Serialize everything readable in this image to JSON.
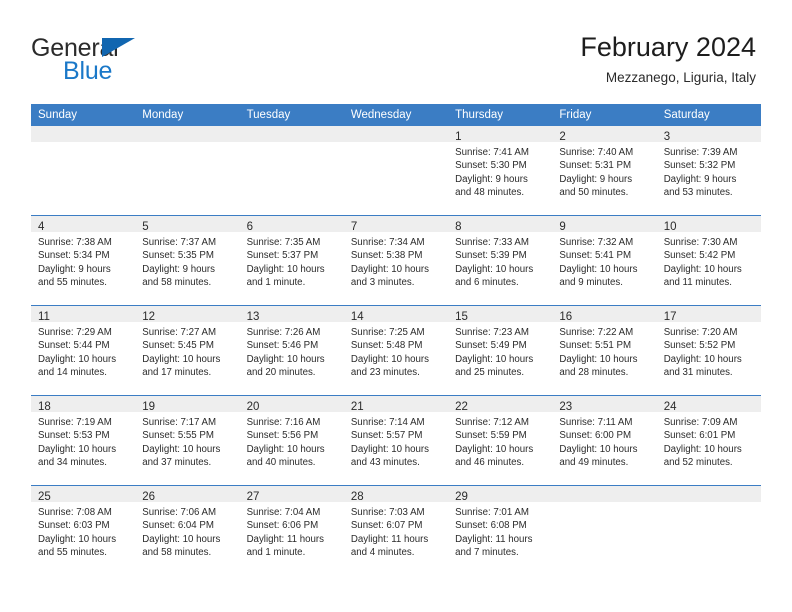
{
  "brand": {
    "name_part1": "General",
    "name_part2": "Blue",
    "flag_icon": "blue-triangle-flag",
    "accent_color": "#1a78c8"
  },
  "header": {
    "title": "February 2024",
    "subtitle": "Mezzanego, Liguria, Italy"
  },
  "theme": {
    "header_row_color": "#3b7dc4",
    "daynum_band_color": "#eeeeee",
    "text_color": "#2b2b2b"
  },
  "weekdays": [
    "Sunday",
    "Monday",
    "Tuesday",
    "Wednesday",
    "Thursday",
    "Friday",
    "Saturday"
  ],
  "weeks": [
    [
      {
        "day": "",
        "sunrise": "",
        "sunset": "",
        "daylight1": "",
        "daylight2": ""
      },
      {
        "day": "",
        "sunrise": "",
        "sunset": "",
        "daylight1": "",
        "daylight2": ""
      },
      {
        "day": "",
        "sunrise": "",
        "sunset": "",
        "daylight1": "",
        "daylight2": ""
      },
      {
        "day": "",
        "sunrise": "",
        "sunset": "",
        "daylight1": "",
        "daylight2": ""
      },
      {
        "day": "1",
        "sunrise": "Sunrise: 7:41 AM",
        "sunset": "Sunset: 5:30 PM",
        "daylight1": "Daylight: 9 hours",
        "daylight2": "and 48 minutes."
      },
      {
        "day": "2",
        "sunrise": "Sunrise: 7:40 AM",
        "sunset": "Sunset: 5:31 PM",
        "daylight1": "Daylight: 9 hours",
        "daylight2": "and 50 minutes."
      },
      {
        "day": "3",
        "sunrise": "Sunrise: 7:39 AM",
        "sunset": "Sunset: 5:32 PM",
        "daylight1": "Daylight: 9 hours",
        "daylight2": "and 53 minutes."
      }
    ],
    [
      {
        "day": "4",
        "sunrise": "Sunrise: 7:38 AM",
        "sunset": "Sunset: 5:34 PM",
        "daylight1": "Daylight: 9 hours",
        "daylight2": "and 55 minutes."
      },
      {
        "day": "5",
        "sunrise": "Sunrise: 7:37 AM",
        "sunset": "Sunset: 5:35 PM",
        "daylight1": "Daylight: 9 hours",
        "daylight2": "and 58 minutes."
      },
      {
        "day": "6",
        "sunrise": "Sunrise: 7:35 AM",
        "sunset": "Sunset: 5:37 PM",
        "daylight1": "Daylight: 10 hours",
        "daylight2": "and 1 minute."
      },
      {
        "day": "7",
        "sunrise": "Sunrise: 7:34 AM",
        "sunset": "Sunset: 5:38 PM",
        "daylight1": "Daylight: 10 hours",
        "daylight2": "and 3 minutes."
      },
      {
        "day": "8",
        "sunrise": "Sunrise: 7:33 AM",
        "sunset": "Sunset: 5:39 PM",
        "daylight1": "Daylight: 10 hours",
        "daylight2": "and 6 minutes."
      },
      {
        "day": "9",
        "sunrise": "Sunrise: 7:32 AM",
        "sunset": "Sunset: 5:41 PM",
        "daylight1": "Daylight: 10 hours",
        "daylight2": "and 9 minutes."
      },
      {
        "day": "10",
        "sunrise": "Sunrise: 7:30 AM",
        "sunset": "Sunset: 5:42 PM",
        "daylight1": "Daylight: 10 hours",
        "daylight2": "and 11 minutes."
      }
    ],
    [
      {
        "day": "11",
        "sunrise": "Sunrise: 7:29 AM",
        "sunset": "Sunset: 5:44 PM",
        "daylight1": "Daylight: 10 hours",
        "daylight2": "and 14 minutes."
      },
      {
        "day": "12",
        "sunrise": "Sunrise: 7:27 AM",
        "sunset": "Sunset: 5:45 PM",
        "daylight1": "Daylight: 10 hours",
        "daylight2": "and 17 minutes."
      },
      {
        "day": "13",
        "sunrise": "Sunrise: 7:26 AM",
        "sunset": "Sunset: 5:46 PM",
        "daylight1": "Daylight: 10 hours",
        "daylight2": "and 20 minutes."
      },
      {
        "day": "14",
        "sunrise": "Sunrise: 7:25 AM",
        "sunset": "Sunset: 5:48 PM",
        "daylight1": "Daylight: 10 hours",
        "daylight2": "and 23 minutes."
      },
      {
        "day": "15",
        "sunrise": "Sunrise: 7:23 AM",
        "sunset": "Sunset: 5:49 PM",
        "daylight1": "Daylight: 10 hours",
        "daylight2": "and 25 minutes."
      },
      {
        "day": "16",
        "sunrise": "Sunrise: 7:22 AM",
        "sunset": "Sunset: 5:51 PM",
        "daylight1": "Daylight: 10 hours",
        "daylight2": "and 28 minutes."
      },
      {
        "day": "17",
        "sunrise": "Sunrise: 7:20 AM",
        "sunset": "Sunset: 5:52 PM",
        "daylight1": "Daylight: 10 hours",
        "daylight2": "and 31 minutes."
      }
    ],
    [
      {
        "day": "18",
        "sunrise": "Sunrise: 7:19 AM",
        "sunset": "Sunset: 5:53 PM",
        "daylight1": "Daylight: 10 hours",
        "daylight2": "and 34 minutes."
      },
      {
        "day": "19",
        "sunrise": "Sunrise: 7:17 AM",
        "sunset": "Sunset: 5:55 PM",
        "daylight1": "Daylight: 10 hours",
        "daylight2": "and 37 minutes."
      },
      {
        "day": "20",
        "sunrise": "Sunrise: 7:16 AM",
        "sunset": "Sunset: 5:56 PM",
        "daylight1": "Daylight: 10 hours",
        "daylight2": "and 40 minutes."
      },
      {
        "day": "21",
        "sunrise": "Sunrise: 7:14 AM",
        "sunset": "Sunset: 5:57 PM",
        "daylight1": "Daylight: 10 hours",
        "daylight2": "and 43 minutes."
      },
      {
        "day": "22",
        "sunrise": "Sunrise: 7:12 AM",
        "sunset": "Sunset: 5:59 PM",
        "daylight1": "Daylight: 10 hours",
        "daylight2": "and 46 minutes."
      },
      {
        "day": "23",
        "sunrise": "Sunrise: 7:11 AM",
        "sunset": "Sunset: 6:00 PM",
        "daylight1": "Daylight: 10 hours",
        "daylight2": "and 49 minutes."
      },
      {
        "day": "24",
        "sunrise": "Sunrise: 7:09 AM",
        "sunset": "Sunset: 6:01 PM",
        "daylight1": "Daylight: 10 hours",
        "daylight2": "and 52 minutes."
      }
    ],
    [
      {
        "day": "25",
        "sunrise": "Sunrise: 7:08 AM",
        "sunset": "Sunset: 6:03 PM",
        "daylight1": "Daylight: 10 hours",
        "daylight2": "and 55 minutes."
      },
      {
        "day": "26",
        "sunrise": "Sunrise: 7:06 AM",
        "sunset": "Sunset: 6:04 PM",
        "daylight1": "Daylight: 10 hours",
        "daylight2": "and 58 minutes."
      },
      {
        "day": "27",
        "sunrise": "Sunrise: 7:04 AM",
        "sunset": "Sunset: 6:06 PM",
        "daylight1": "Daylight: 11 hours",
        "daylight2": "and 1 minute."
      },
      {
        "day": "28",
        "sunrise": "Sunrise: 7:03 AM",
        "sunset": "Sunset: 6:07 PM",
        "daylight1": "Daylight: 11 hours",
        "daylight2": "and 4 minutes."
      },
      {
        "day": "29",
        "sunrise": "Sunrise: 7:01 AM",
        "sunset": "Sunset: 6:08 PM",
        "daylight1": "Daylight: 11 hours",
        "daylight2": "and 7 minutes."
      },
      {
        "day": "",
        "sunrise": "",
        "sunset": "",
        "daylight1": "",
        "daylight2": ""
      },
      {
        "day": "",
        "sunrise": "",
        "sunset": "",
        "daylight1": "",
        "daylight2": ""
      }
    ]
  ]
}
